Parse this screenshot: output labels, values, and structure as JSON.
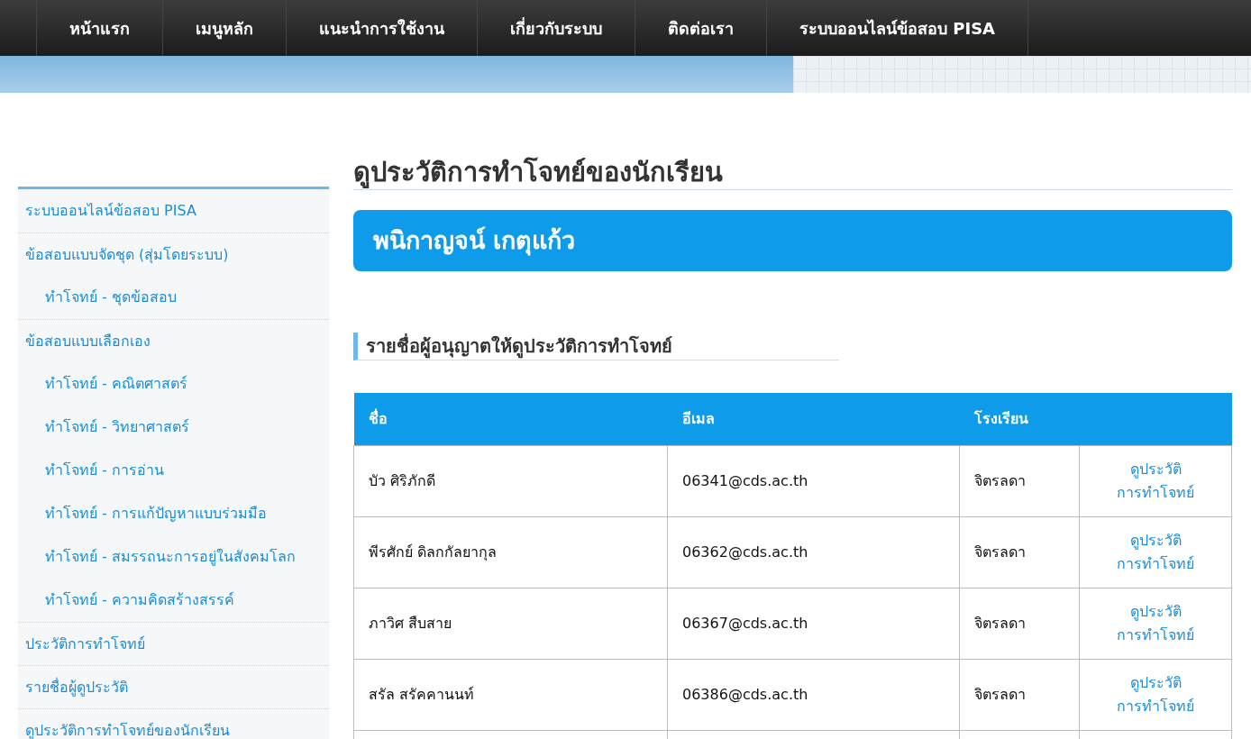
{
  "nav": {
    "items": [
      {
        "label": "หน้าแรก"
      },
      {
        "label": "เมนูหลัก"
      },
      {
        "label": "แนะนำการใช้งาน"
      },
      {
        "label": "เกี่ยวกับระบบ"
      },
      {
        "label": "ติดต่อเรา"
      },
      {
        "label": "ระบบออนไลน์ข้อสอบ PISA"
      }
    ]
  },
  "sidebar": {
    "items": [
      {
        "kind": "section",
        "label": "ระบบออนไลน์ข้อสอบ PISA"
      },
      {
        "kind": "section",
        "label": "ข้อสอบแบบจัดชุด (สุ่มโดยระบบ)"
      },
      {
        "kind": "sub",
        "label": "ทำโจทย์ - ชุดข้อสอบ"
      },
      {
        "kind": "section",
        "label": "ข้อสอบแบบเลือกเอง"
      },
      {
        "kind": "sub",
        "label": "ทำโจทย์ - คณิตศาสตร์"
      },
      {
        "kind": "sub",
        "label": "ทำโจทย์ - วิทยาศาสตร์"
      },
      {
        "kind": "sub",
        "label": "ทำโจทย์ - การอ่าน"
      },
      {
        "kind": "sub",
        "label": "ทำโจทย์ - การแก้ปัญหาแบบร่วมมือ"
      },
      {
        "kind": "sub",
        "label": "ทำโจทย์ - สมรรถนะการอยู่ในสังคมโลก"
      },
      {
        "kind": "sub",
        "label": "ทำโจทย์ - ความคิดสร้างสรรค์"
      },
      {
        "kind": "section",
        "label": "ประวัติการทำโจทย์"
      },
      {
        "kind": "section",
        "label": "รายชื่อผู้ดูประวัติ"
      },
      {
        "kind": "section",
        "label": "ดูประวัติการทำโจทย์ของนักเรียน"
      }
    ]
  },
  "main": {
    "title": "ดูประวัติการทำโจทย์ของนักเรียน",
    "student_name": "พนิกาญจน์ เกตุแก้ว",
    "subheading": "รายชื่อผู้อนุญาตให้ดูประวัติการทำโจทย์",
    "table": {
      "columns": [
        "ชื่อ",
        "อีเมล",
        "โรงเรียน"
      ],
      "rows": [
        {
          "name": "บัว ศิริภักดี",
          "email": "06341@cds.ac.th",
          "school": "จิตรลดา",
          "link_lines": [
            "ดูประวัติ",
            "การทำโจทย์"
          ]
        },
        {
          "name": "พีรศักย์ ดิลกกัลยากุล",
          "email": "06362@cds.ac.th",
          "school": "จิตรลดา",
          "link_lines": [
            "ดูประวัติ",
            "การทำโจทย์"
          ]
        },
        {
          "name": "ภาวิศ สืบสาย",
          "email": "06367@cds.ac.th",
          "school": "จิตรลดา",
          "link_lines": [
            "ดูประวัติ",
            "การทำโจทย์"
          ]
        },
        {
          "name": "สรัล สรัคคานนท์",
          "email": "06386@cds.ac.th",
          "school": "จิตรลดา",
          "link_lines": [
            "ดูประวัติ",
            "การทำโจทย์"
          ]
        }
      ]
    }
  }
}
